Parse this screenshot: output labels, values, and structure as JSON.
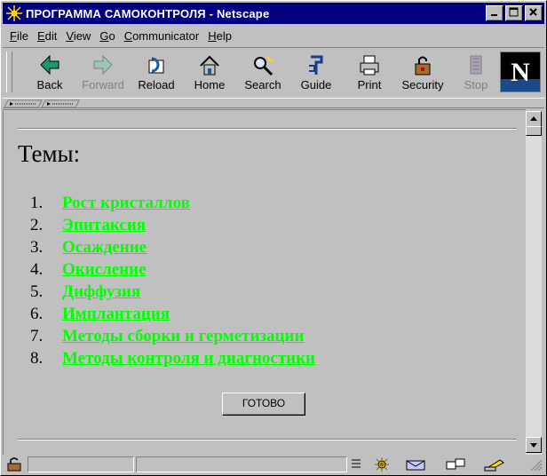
{
  "window": {
    "title": "ПРОГРАММА САМОКОНТРОЛЯ - Netscape"
  },
  "menu": [
    "File",
    "Edit",
    "View",
    "Go",
    "Communicator",
    "Help"
  ],
  "menu_accels": [
    "F",
    "E",
    "V",
    "G",
    "C",
    "H"
  ],
  "toolbar": [
    {
      "label": "Back",
      "icon": "back-arrow-icon",
      "enabled": true
    },
    {
      "label": "Forward",
      "icon": "forward-arrow-icon",
      "enabled": false
    },
    {
      "label": "Reload",
      "icon": "reload-icon",
      "enabled": true
    },
    {
      "label": "Home",
      "icon": "home-icon",
      "enabled": true
    },
    {
      "label": "Search",
      "icon": "search-icon",
      "enabled": true
    },
    {
      "label": "Guide",
      "icon": "guide-icon",
      "enabled": true
    },
    {
      "label": "Print",
      "icon": "print-icon",
      "enabled": true
    },
    {
      "label": "Security",
      "icon": "security-lock-icon",
      "enabled": true
    },
    {
      "label": "Stop",
      "icon": "stop-icon",
      "enabled": false
    }
  ],
  "page": {
    "heading": "Темы:",
    "topics": [
      "Рост кристаллов",
      "Эпитаксия",
      "Осаждение",
      "Окисление",
      "Диффузия",
      "Имплантация",
      "Методы сборки и герметизации",
      "Методы контроля и диагностики"
    ],
    "numbers": [
      "1.",
      "2.",
      "3.",
      "4.",
      "5.",
      "6.",
      "7.",
      "8."
    ],
    "done_label": "ГОТОВО"
  },
  "colors": {
    "link": "#00ff00",
    "titlebar": "#000080",
    "chrome": "#c0c0c0"
  }
}
